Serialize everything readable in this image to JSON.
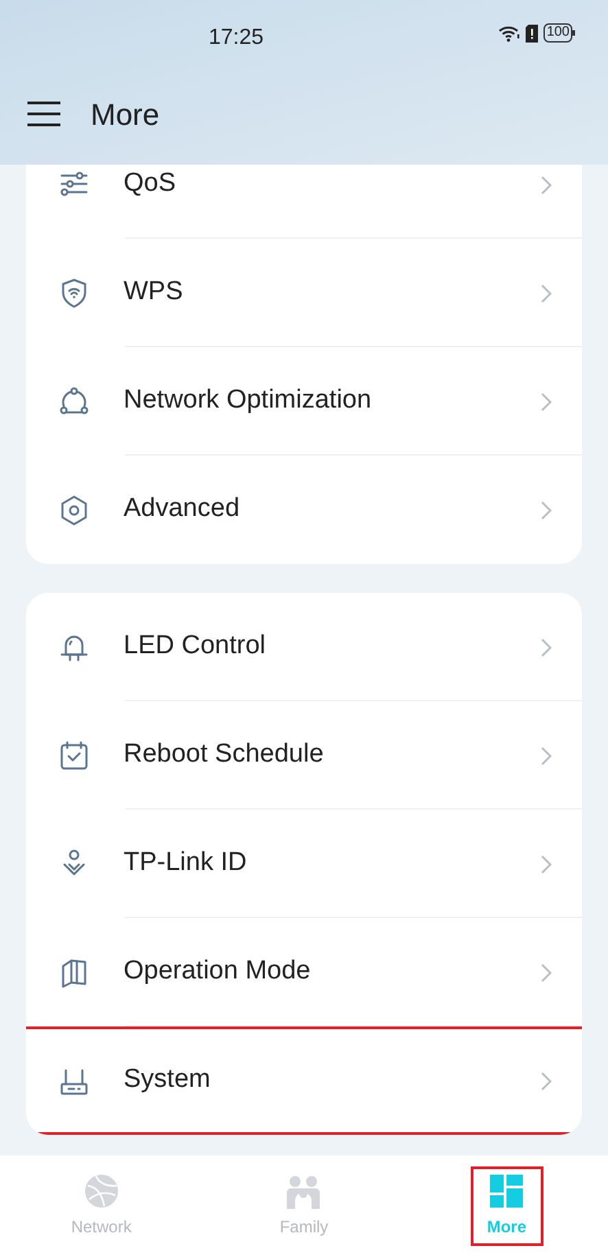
{
  "status_bar": {
    "time": "17:25",
    "battery": "100"
  },
  "header": {
    "title": "More"
  },
  "sections": [
    {
      "items": [
        {
          "label": "QoS",
          "kind": "sliders",
          "highlighted": false
        },
        {
          "label": "WPS",
          "kind": "shield",
          "highlighted": false
        },
        {
          "label": "Network Optimization",
          "kind": "nodes",
          "highlighted": false
        },
        {
          "label": "Advanced",
          "kind": "hexagon",
          "highlighted": false
        }
      ]
    },
    {
      "items": [
        {
          "label": "LED Control",
          "kind": "led",
          "highlighted": false
        },
        {
          "label": "Reboot Schedule",
          "kind": "calendar",
          "highlighted": false
        },
        {
          "label": "TP-Link ID",
          "kind": "person",
          "highlighted": false
        },
        {
          "label": "Operation Mode",
          "kind": "map",
          "highlighted": false
        },
        {
          "label": "System",
          "kind": "router",
          "highlighted": true
        }
      ]
    }
  ],
  "tabs": [
    {
      "label": "Network",
      "kind": "globe",
      "selected": false,
      "highlighted": false
    },
    {
      "label": "Family",
      "kind": "family",
      "selected": false,
      "highlighted": false
    },
    {
      "label": "More",
      "kind": "grid",
      "selected": true,
      "highlighted": true
    }
  ]
}
